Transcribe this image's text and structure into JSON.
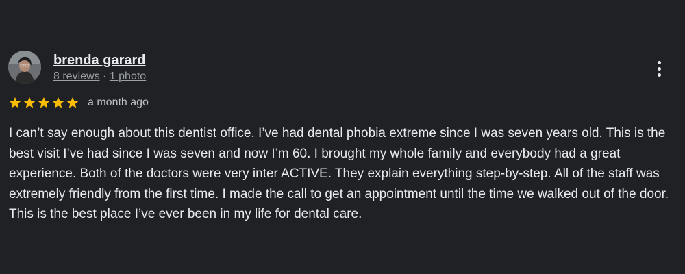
{
  "review": {
    "reviewer_name": "brenda garard",
    "reviews_count": "8 reviews",
    "separator": "·",
    "photos_count": "1 photo",
    "rating": 5,
    "rating_max": 5,
    "time_ago": "a month ago",
    "text": "I can’t say enough about this dentist office. I’ve had dental phobia extreme since I was seven years old. This is the best visit I’ve had since I was seven and now I’m 60. I brought my whole family and everybody had a great experience. Both of the doctors were very inter ACTIVE. They explain everything step-by-step. All of the staff was extremely friendly from the first time. I made the call to get an appointment until the time we walked out of the door. This is the best place I’ve ever been in my life for dental care."
  },
  "icons": {
    "more": "more-vert-icon",
    "star": "star-icon",
    "avatar": "avatar"
  },
  "colors": {
    "background": "#202124",
    "star": "#fbbc04",
    "text": "#e8eaed",
    "muted": "#9aa0a6"
  }
}
